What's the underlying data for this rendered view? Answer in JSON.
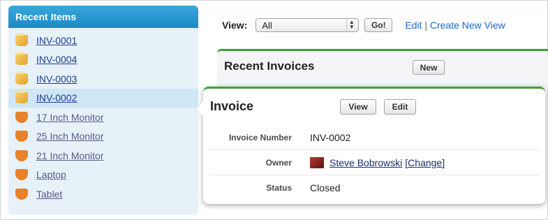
{
  "sidebar": {
    "title": "Recent Items",
    "items": [
      {
        "label": "INV-0001",
        "icon": "invoice-icon"
      },
      {
        "label": "INV-0004",
        "icon": "invoice-icon"
      },
      {
        "label": "INV-0003",
        "icon": "invoice-icon"
      },
      {
        "label": "INV-0002",
        "icon": "invoice-icon"
      },
      {
        "label": "17 Inch Monitor",
        "icon": "product-icon"
      },
      {
        "label": "25 Inch Monitor",
        "icon": "product-icon"
      },
      {
        "label": "21 Inch Monitor",
        "icon": "product-icon"
      },
      {
        "label": "Laptop",
        "icon": "product-icon"
      },
      {
        "label": "Tablet",
        "icon": "product-icon"
      }
    ]
  },
  "toolbar": {
    "view_label": "View:",
    "view_selected": "All",
    "go_label": "Go!",
    "edit_link": "Edit",
    "separator": " | ",
    "create_link": "Create New View"
  },
  "recent": {
    "title": "Recent Invoices",
    "new_label": "New"
  },
  "popup": {
    "title": "Invoice",
    "view_label": "View",
    "edit_label": "Edit",
    "fields": [
      {
        "label": "Invoice Number",
        "value": "INV-0002"
      },
      {
        "label": "Owner",
        "value": "Steve Bobrowski",
        "action": "[Change]"
      },
      {
        "label": "Status",
        "value": "Closed"
      }
    ]
  },
  "colors": {
    "sidebar_header": "#1b8ac4",
    "sidebar_bg": "#e7f1f8",
    "accent_green": "#3fa037",
    "link": "#1a3e96"
  }
}
